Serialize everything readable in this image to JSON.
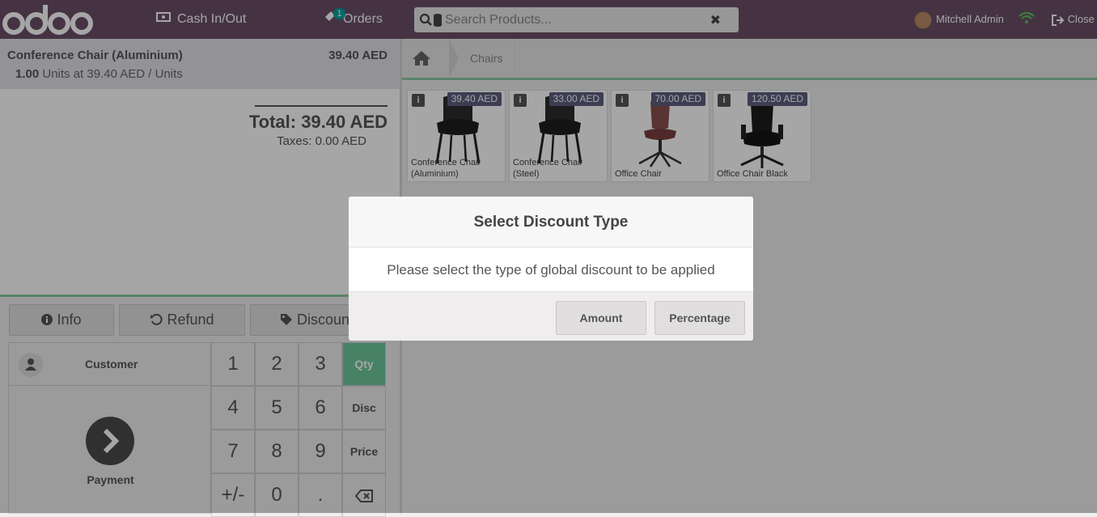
{
  "header": {
    "logo_text": "odoo",
    "cash_in_out": "Cash In/Out",
    "orders_label": "Orders",
    "orders_badge": "1",
    "search_placeholder": "Search Products...",
    "user_name": "Mitchell Admin",
    "close_label": "Close"
  },
  "order": {
    "line": {
      "name": "Conference Chair (Aluminium)",
      "price": "39.40 AED",
      "qty": "1.00",
      "details": "Units at 39.40 AED / Units"
    },
    "total": "Total: 39.40 AED",
    "taxes": "Taxes: 0.00 AED"
  },
  "controls": {
    "info": "Info",
    "refund": "Refund",
    "discount": "Discount",
    "customer": "Customer",
    "payment": "Payment",
    "keys": [
      "1",
      "2",
      "3",
      "4",
      "5",
      "6",
      "7",
      "8",
      "9",
      "+/-",
      "0",
      "."
    ],
    "modes": [
      "Qty",
      "Disc",
      "Price"
    ]
  },
  "breadcrumb": {
    "category": "Chairs"
  },
  "products": [
    {
      "name": "Conference Chair (Aluminium)",
      "price": "39.40 AED",
      "image": "black-chair"
    },
    {
      "name": "Conference Chair (Steel)",
      "price": "33.00 AED",
      "image": "black-chair"
    },
    {
      "name": "Office Chair",
      "price": "70.00 AED",
      "image": "red-swivel-chair"
    },
    {
      "name": "Office Chair Black",
      "price": "120.50 AED",
      "image": "black-office-chair"
    }
  ],
  "modal": {
    "title": "Select Discount Type",
    "body": "Please select the type of global discount to be applied",
    "amount_button": "Amount",
    "percentage_button": "Percentage"
  },
  "colors": {
    "topbar": "#6b4f67",
    "accent_green": "#6ec89b",
    "price_tag": "#5d5e7f"
  }
}
